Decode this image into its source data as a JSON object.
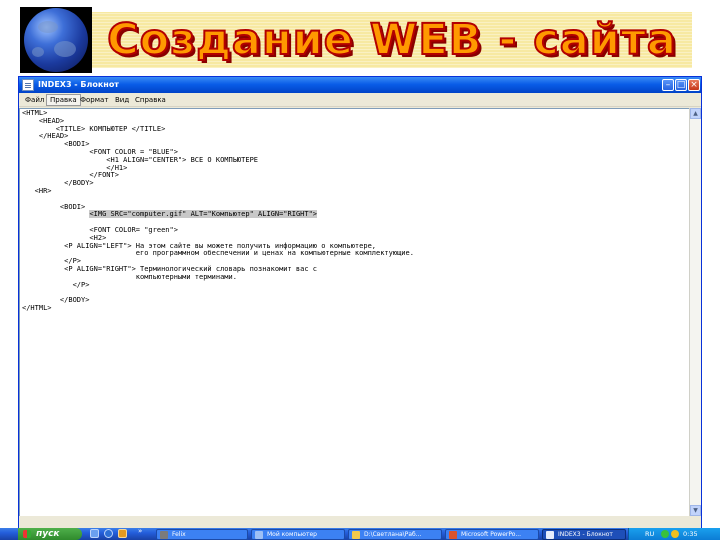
{
  "slide": {
    "title": "Создание WEB - сайта"
  },
  "window": {
    "title": "INDEX3 - Блокнот",
    "menu": [
      "Файл",
      "Правка",
      "Формат",
      "Вид",
      "Справка"
    ],
    "active_menu_index": 1
  },
  "editor": {
    "lines": [
      "<HTML>",
      "    <HEAD>",
      "        <TITLE> КОМПЬЮТЕР </TITLE>",
      "    </HEAD>",
      "          <BODI>",
      "                <FONT COLOR = \"BLUE\">",
      "                    <H1 ALIGN=\"CENTER\"> ВСЕ О КОМПЬЮТЕРЕ",
      "                    </H1>",
      "                </FONT>",
      "          </BODY>",
      "   <HR>",
      "",
      "         <BODI>",
      "                <IMG SRC=\"computer.gif\" ALT=\"Компьютер\" ALIGN=\"RIGHT\">",
      "",
      "                <FONT COLOR= \"green\">",
      "                <H2>",
      "          <P ALIGN=\"LEFT\"> На этом сайте вы можете получить информацию о компьютере,",
      "                           его программном обеспечении и ценах на компьютерные комплектующие.",
      "          </P>",
      "          <P ALIGN=\"RIGHT\"> Терминологический словарь познакомит вас с",
      "                           компьютерными терминами.",
      "            </P>",
      "",
      "         </BODY>",
      "</HTML>"
    ],
    "highlighted_line_index": 13,
    "highlight_color": "#c8c8c8"
  },
  "taskbar": {
    "start_label": "пуск",
    "quicklaunch": [
      "show-desktop-icon",
      "browser-icon",
      "media-icon"
    ],
    "quicklaunch_more": "»",
    "tasks": [
      {
        "label": "Felix",
        "icon": "felix-icon",
        "color": "#7b7b7b",
        "active": false
      },
      {
        "label": "Мой компьютер",
        "icon": "my-computer-icon",
        "color": "#9ec0f5",
        "active": false
      },
      {
        "label": "D:\\Светлана\\Раб...",
        "icon": "folder-icon",
        "color": "#f2c94c",
        "active": false
      },
      {
        "label": "Microsoft PowerPo...",
        "icon": "powerpoint-icon",
        "color": "#d9532c",
        "active": false
      },
      {
        "label": "INDEX3 - Блокнот",
        "icon": "notepad-icon",
        "color": "#e8eefc",
        "active": true
      }
    ],
    "language": "RU",
    "clock": "0:35"
  },
  "colors": {
    "title_fill": "#ff9900",
    "title_outline": "#b30000",
    "title_band": "#f7e9a2",
    "xp_titlebar": "#0a5de8",
    "taskbar": "#245edb",
    "start_button": "#2f8a2c"
  }
}
